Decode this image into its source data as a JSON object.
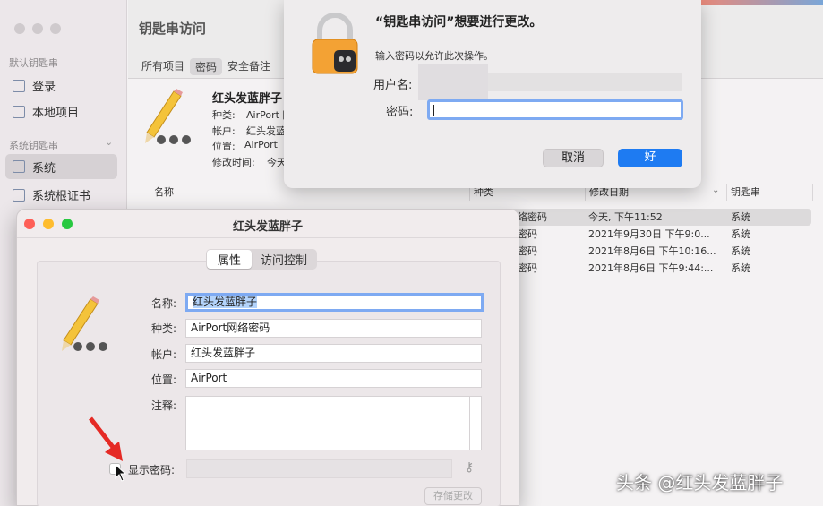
{
  "sidebar": {
    "default_header": "默认钥匙串",
    "default_items": [
      {
        "label": "登录"
      },
      {
        "label": "本地项目"
      }
    ],
    "system_header": "系统钥匙串",
    "system_items": [
      {
        "label": "系统"
      },
      {
        "label": "系统根证书"
      }
    ]
  },
  "main": {
    "title": "钥匙串访问",
    "tabs": [
      "所有项目",
      "密码",
      "安全备注"
    ],
    "detail": {
      "name": "红头发蓝胖子",
      "kind_label": "种类:",
      "kind_value": "AirPort 网",
      "account_label": "帐户:",
      "account_value": "红头发蓝",
      "location_label": "位置:",
      "location_value": "AirPort",
      "modified_label": "修改时间:",
      "modified_value": "今天"
    },
    "columns": [
      "名称",
      "种类",
      "修改日期",
      "钥匙串"
    ],
    "rows": [
      {
        "kind": "络密码",
        "date": "今天, 下午11:52",
        "keychain": "系统"
      },
      {
        "kind": "密码",
        "date": "2021年9月30日 下午9:0...",
        "keychain": "系统"
      },
      {
        "kind": "密码",
        "date": "2021年8月6日 下午10:16...",
        "keychain": "系统"
      },
      {
        "kind": "密码",
        "date": "2021年8月6日 下午9:44:...",
        "keychain": "系统"
      }
    ]
  },
  "auth_dialog": {
    "title": "“钥匙串访问”想要进行更改。",
    "message": "输入密码以允许此次操作。",
    "username_label": "用户名:",
    "password_label": "密码:",
    "cancel_label": "取消",
    "ok_label": "好",
    "ok_color": "#1e7bf2"
  },
  "item_window": {
    "title": "红头发蓝胖子",
    "tabs": [
      "属性",
      "访问控制"
    ],
    "name_label": "名称:",
    "name_value": "红头发蓝胖子",
    "kind_label": "种类:",
    "kind_value": "AirPort网络密码",
    "account_label": "帐户:",
    "account_value": "红头发蓝胖子",
    "location_label": "位置:",
    "location_value": "AirPort",
    "comment_label": "注释:",
    "show_password_label": "显示密码:",
    "save_label": "存储更改"
  },
  "watermark": "头条 @红头发蓝胖子"
}
